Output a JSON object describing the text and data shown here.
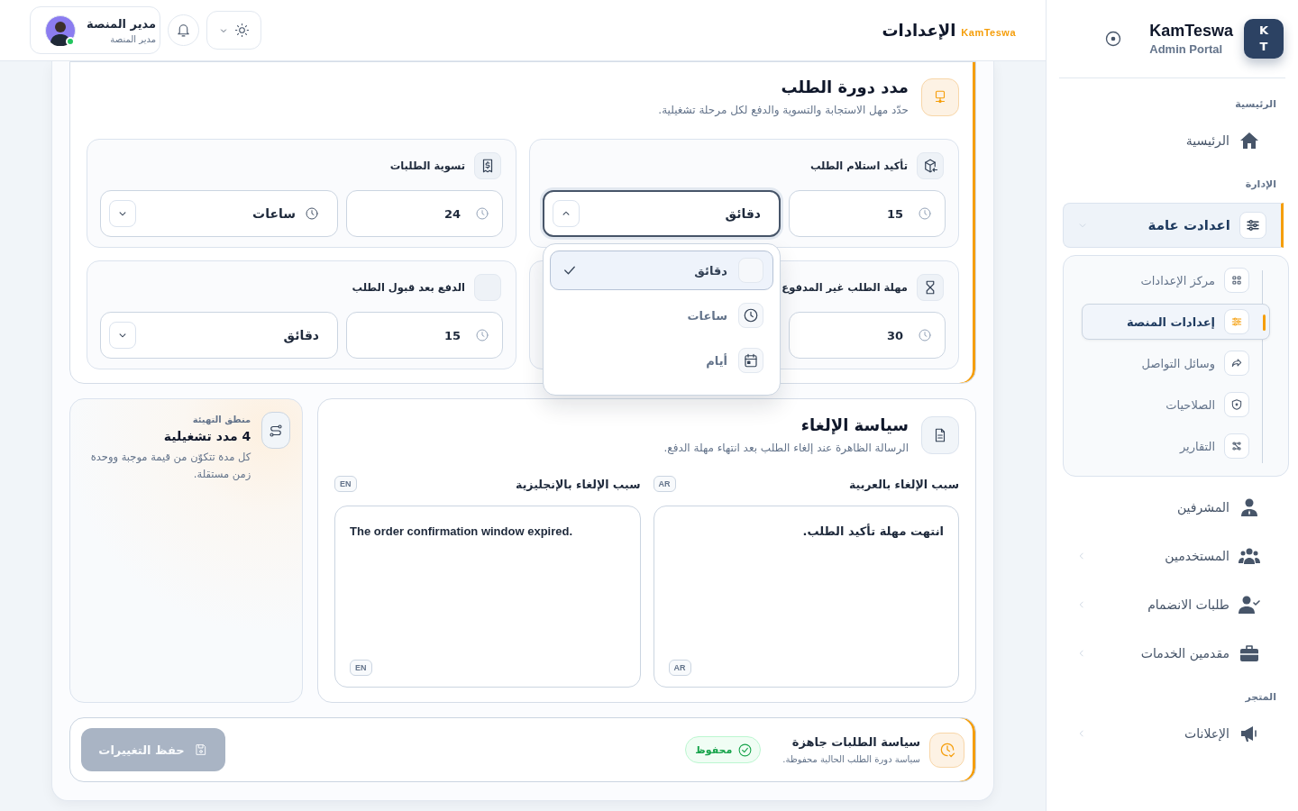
{
  "sidebar": {
    "brand": {
      "initials": [
        "K",
        "T"
      ],
      "name": "KamTeswa",
      "subtitle": "Admin Portal"
    },
    "sections": [
      {
        "title": "الرئيسية",
        "items": [
          {
            "label": "الرئيسية",
            "selected": false,
            "expandable": false
          }
        ]
      },
      {
        "title": "الإدارة",
        "items": [
          {
            "label": "اعدادت عامة",
            "selected": true,
            "expandable": true,
            "expanded": true,
            "children": [
              {
                "label": "مركز الإعدادات",
                "selected": false
              },
              {
                "label": "إعدادات المنصة",
                "selected": true
              },
              {
                "label": "وسائل التواصل",
                "selected": false
              },
              {
                "label": "الصلاحيات",
                "selected": false
              },
              {
                "label": "التقارير",
                "selected": false
              }
            ]
          },
          {
            "label": "المشرفين",
            "selected": false,
            "expandable": false
          },
          {
            "label": "المستخدمين",
            "selected": false,
            "expandable": true,
            "expanded": false
          },
          {
            "label": "طلبات الانضمام",
            "selected": false,
            "expandable": true,
            "expanded": false
          },
          {
            "label": "مقدمين الخدمات",
            "selected": false,
            "expandable": true,
            "expanded": false
          }
        ]
      },
      {
        "title": "المتجر",
        "items": [
          {
            "label": "الإعلانات",
            "selected": false,
            "expandable": true,
            "expanded": false
          }
        ]
      }
    ]
  },
  "topbar": {
    "brand": "KamTeswa",
    "title": "الإعدادات",
    "user": {
      "name": "مدير المنصة",
      "role": "مدير المنصة",
      "online": true
    }
  },
  "lifecycle": {
    "title": "مدد دورة الطلب",
    "subtitle": "حدّد مهل الاستجابة والتسوية والدفع لكل مرحلة تشغيلية.",
    "durations": [
      {
        "title": "تأكيد استلام الطلب",
        "value": "15",
        "unit": {
          "label": "دقائق",
          "kind": "minutes",
          "open": true
        }
      },
      {
        "title": "تسوية الطلبات",
        "value": "24",
        "unit": {
          "label": "ساعات",
          "kind": "hours",
          "open": false
        }
      },
      {
        "title": "مهلة الطلب غير المدفوع",
        "value": "30"
      },
      {
        "title": "الدفع بعد قبول الطلب",
        "value": "15",
        "unit": {
          "label": "دقائق",
          "kind": "minutes",
          "open": false
        }
      }
    ],
    "unit_menu": {
      "options": [
        {
          "label": "دقائق",
          "kind": "minutes",
          "selected": true
        },
        {
          "label": "ساعات",
          "kind": "hours",
          "selected": false
        },
        {
          "label": "أيام",
          "kind": "days",
          "selected": false
        }
      ]
    }
  },
  "cancellation": {
    "title": "سياسة الإلغاء",
    "subtitle": "الرسالة الظاهرة عند إلغاء الطلب بعد انتهاء مهلة الدفع.",
    "fields": [
      {
        "label": "سبب الإلغاء بالعربية",
        "lang": "AR",
        "value": "انتهت مهلة تأكيد الطلب.",
        "value_lang": "AR",
        "kind": "rtl"
      },
      {
        "label": "سبب الإلغاء بالإنجليزية",
        "lang": "EN",
        "value": "The order confirmation window expired.",
        "value_lang": "EN",
        "kind": "ltr"
      }
    ]
  },
  "info": {
    "eyebrow": "منطق التهيئة",
    "title": "4 مدد تشغيلية",
    "text": "كل مدة تتكوّن من قيمة موجبة ووحدة زمن مستقلة."
  },
  "footer": {
    "title": "سياسة الطلبات جاهزة",
    "subtitle": "سياسة دورة الطلب الحالية محفوظة.",
    "badge": "محفوظ",
    "save": {
      "label": "حفظ التغييرات",
      "disabled": true
    }
  }
}
